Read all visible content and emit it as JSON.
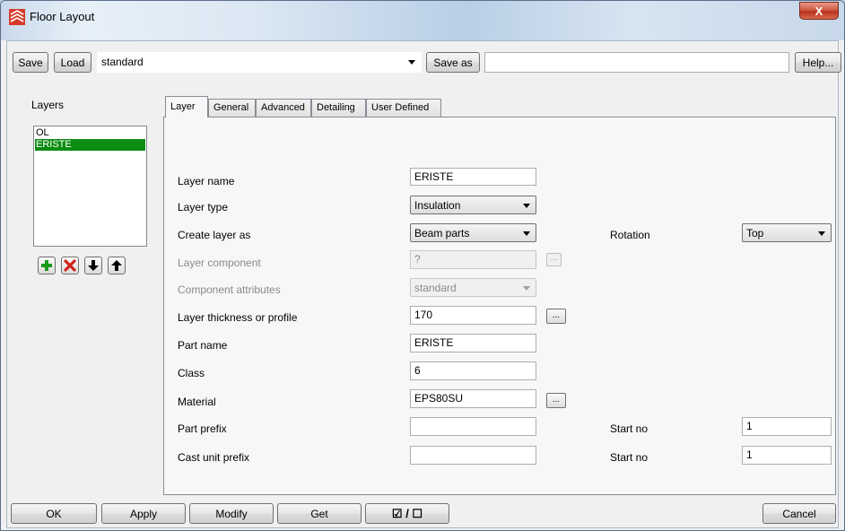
{
  "window": {
    "title": "Floor Layout",
    "close_label": "X"
  },
  "toolbar": {
    "save_label": "Save",
    "load_label": "Load",
    "preset_value": "standard",
    "save_as_label": "Save as",
    "save_as_value": "",
    "help_label": "Help..."
  },
  "layers": {
    "heading": "Layers",
    "items": [
      "OL",
      "ERISTE"
    ],
    "selected_index": 1
  },
  "tabs": [
    "Layer",
    "General",
    "Advanced",
    "Detailing",
    "User Defined"
  ],
  "active_tab": "Layer",
  "form": {
    "layer_name_label": "Layer name",
    "layer_name_value": "ERISTE",
    "layer_type_label": "Layer type",
    "layer_type_value": "Insulation",
    "create_as_label": "Create layer as",
    "create_as_value": "Beam parts",
    "rotation_label": "Rotation",
    "rotation_value": "Top",
    "component_label": "Layer component",
    "component_value": "?",
    "component_attr_label": "Component attributes",
    "component_attr_value": "standard",
    "thickness_label": "Layer thickness or profile",
    "thickness_value": "170",
    "part_name_label": "Part name",
    "part_name_value": "ERISTE",
    "class_label": "Class",
    "class_value": "6",
    "material_label": "Material",
    "material_value": "EPS80SU",
    "part_prefix_label": "Part prefix",
    "part_prefix_value": "",
    "part_start_label": "Start no",
    "part_start_value": "1",
    "cast_prefix_label": "Cast unit prefix",
    "cast_prefix_value": "",
    "cast_start_label": "Start no",
    "cast_start_value": "1",
    "ellipsis_label": "..."
  },
  "bottom": {
    "ok_label": "OK",
    "apply_label": "Apply",
    "modify_label": "Modify",
    "get_label": "Get",
    "toggle_label": "☑ / ☐",
    "cancel_label": "Cancel"
  },
  "colors": {
    "selection_green": "#0b8c12",
    "close_red": "#c8432b"
  }
}
